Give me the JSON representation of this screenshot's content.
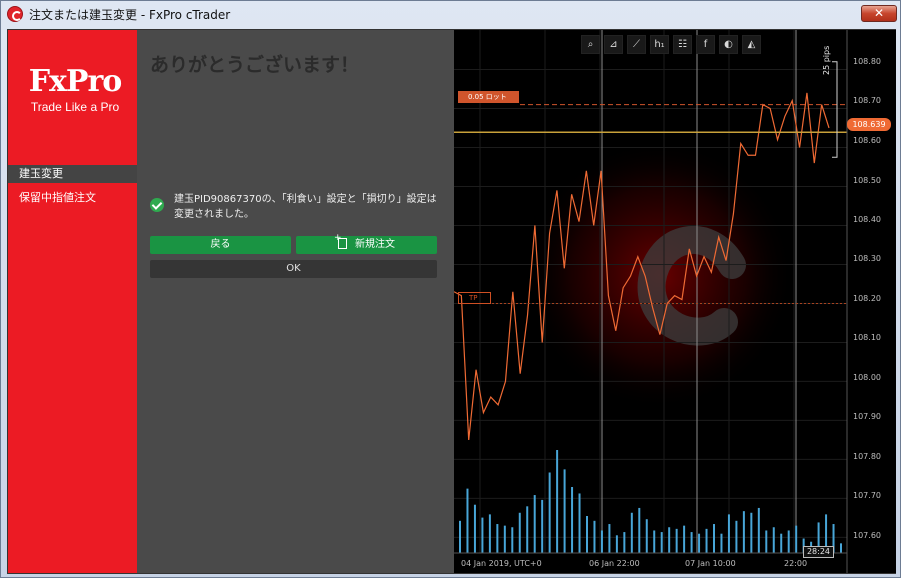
{
  "window": {
    "title": "注文または建玉変更 - FxPro cTrader",
    "close_label": "✕"
  },
  "sidebar": {
    "logo": "FxPro",
    "tagline": "Trade Like a Pro",
    "items": [
      {
        "label": "建玉変更",
        "active": true
      },
      {
        "label": "保留中指値注文",
        "active": false
      }
    ]
  },
  "panel": {
    "heading": "ありがとうございます！",
    "message": "建玉PID90867370の、「利食い」設定と「損切り」設定は変更されました。",
    "back_label": "戻る",
    "new_order_label": "新規注文",
    "ok_label": "OK"
  },
  "chart": {
    "toolbar_icons": [
      "zoom-icon",
      "drawing-icon",
      "indicator-icon",
      "timeframe-icon",
      "checklist-icon",
      "facebook-icon",
      "sentiment-icon",
      "mode-icon"
    ],
    "toolbar_glyphs": [
      "⌕",
      "⊿",
      "⟋",
      "h₁",
      "☷",
      "f",
      "◐",
      "◭"
    ],
    "current_price": "108.639",
    "order_label": "0.05 ロット",
    "tp_label": "TP",
    "pips_label": "25 pips",
    "countdown": "28:24",
    "price_labels": [
      "108.80",
      "108.70",
      "108.60",
      "108.50",
      "108.40",
      "108.30",
      "108.20",
      "108.10",
      "108.00",
      "107.90",
      "107.80",
      "107.70",
      "107.60"
    ],
    "time_labels": [
      "04 Jan 2019, UTC+0",
      "06 Jan 22:00",
      "07 Jan 10:00",
      "22:00"
    ],
    "colors": {
      "line": "#ef6a34",
      "volume": "#48a6d8",
      "current_line": "#c8a13a",
      "red_panel": "#ec1b24",
      "button_green": "#1a9443"
    }
  },
  "chart_data": {
    "type": "line",
    "price_series": [
      108.23,
      108.22,
      107.85,
      108.03,
      107.92,
      107.96,
      107.94,
      108.0,
      108.23,
      108.02,
      108.17,
      108.4,
      108.1,
      108.38,
      108.49,
      108.29,
      108.48,
      108.41,
      108.54,
      108.4,
      108.54,
      108.22,
      108.13,
      108.24,
      108.27,
      108.32,
      108.27,
      108.19,
      108.12,
      108.2,
      108.22,
      108.21,
      108.34,
      108.27,
      108.32,
      108.28,
      108.37,
      108.31,
      108.43,
      108.61,
      108.58,
      108.58,
      108.71,
      108.7,
      108.62,
      108.68,
      108.72,
      108.6,
      108.74,
      108.56,
      108.71,
      108.65
    ],
    "volume_series": [
      20,
      40,
      30,
      22,
      24,
      18,
      17,
      16,
      25,
      29,
      36,
      33,
      50,
      64,
      52,
      41,
      37,
      23,
      20,
      14,
      18,
      11,
      13,
      25,
      28,
      21,
      14,
      13,
      16,
      15,
      17,
      13,
      12,
      15,
      18,
      12,
      24,
      20,
      26,
      25,
      28,
      14,
      16,
      12,
      14,
      17,
      9,
      7,
      19,
      24,
      18,
      6
    ],
    "ylim": [
      107.56,
      108.85
    ],
    "current_price": 108.639,
    "order_price": 108.71,
    "tp_price": 108.2
  }
}
